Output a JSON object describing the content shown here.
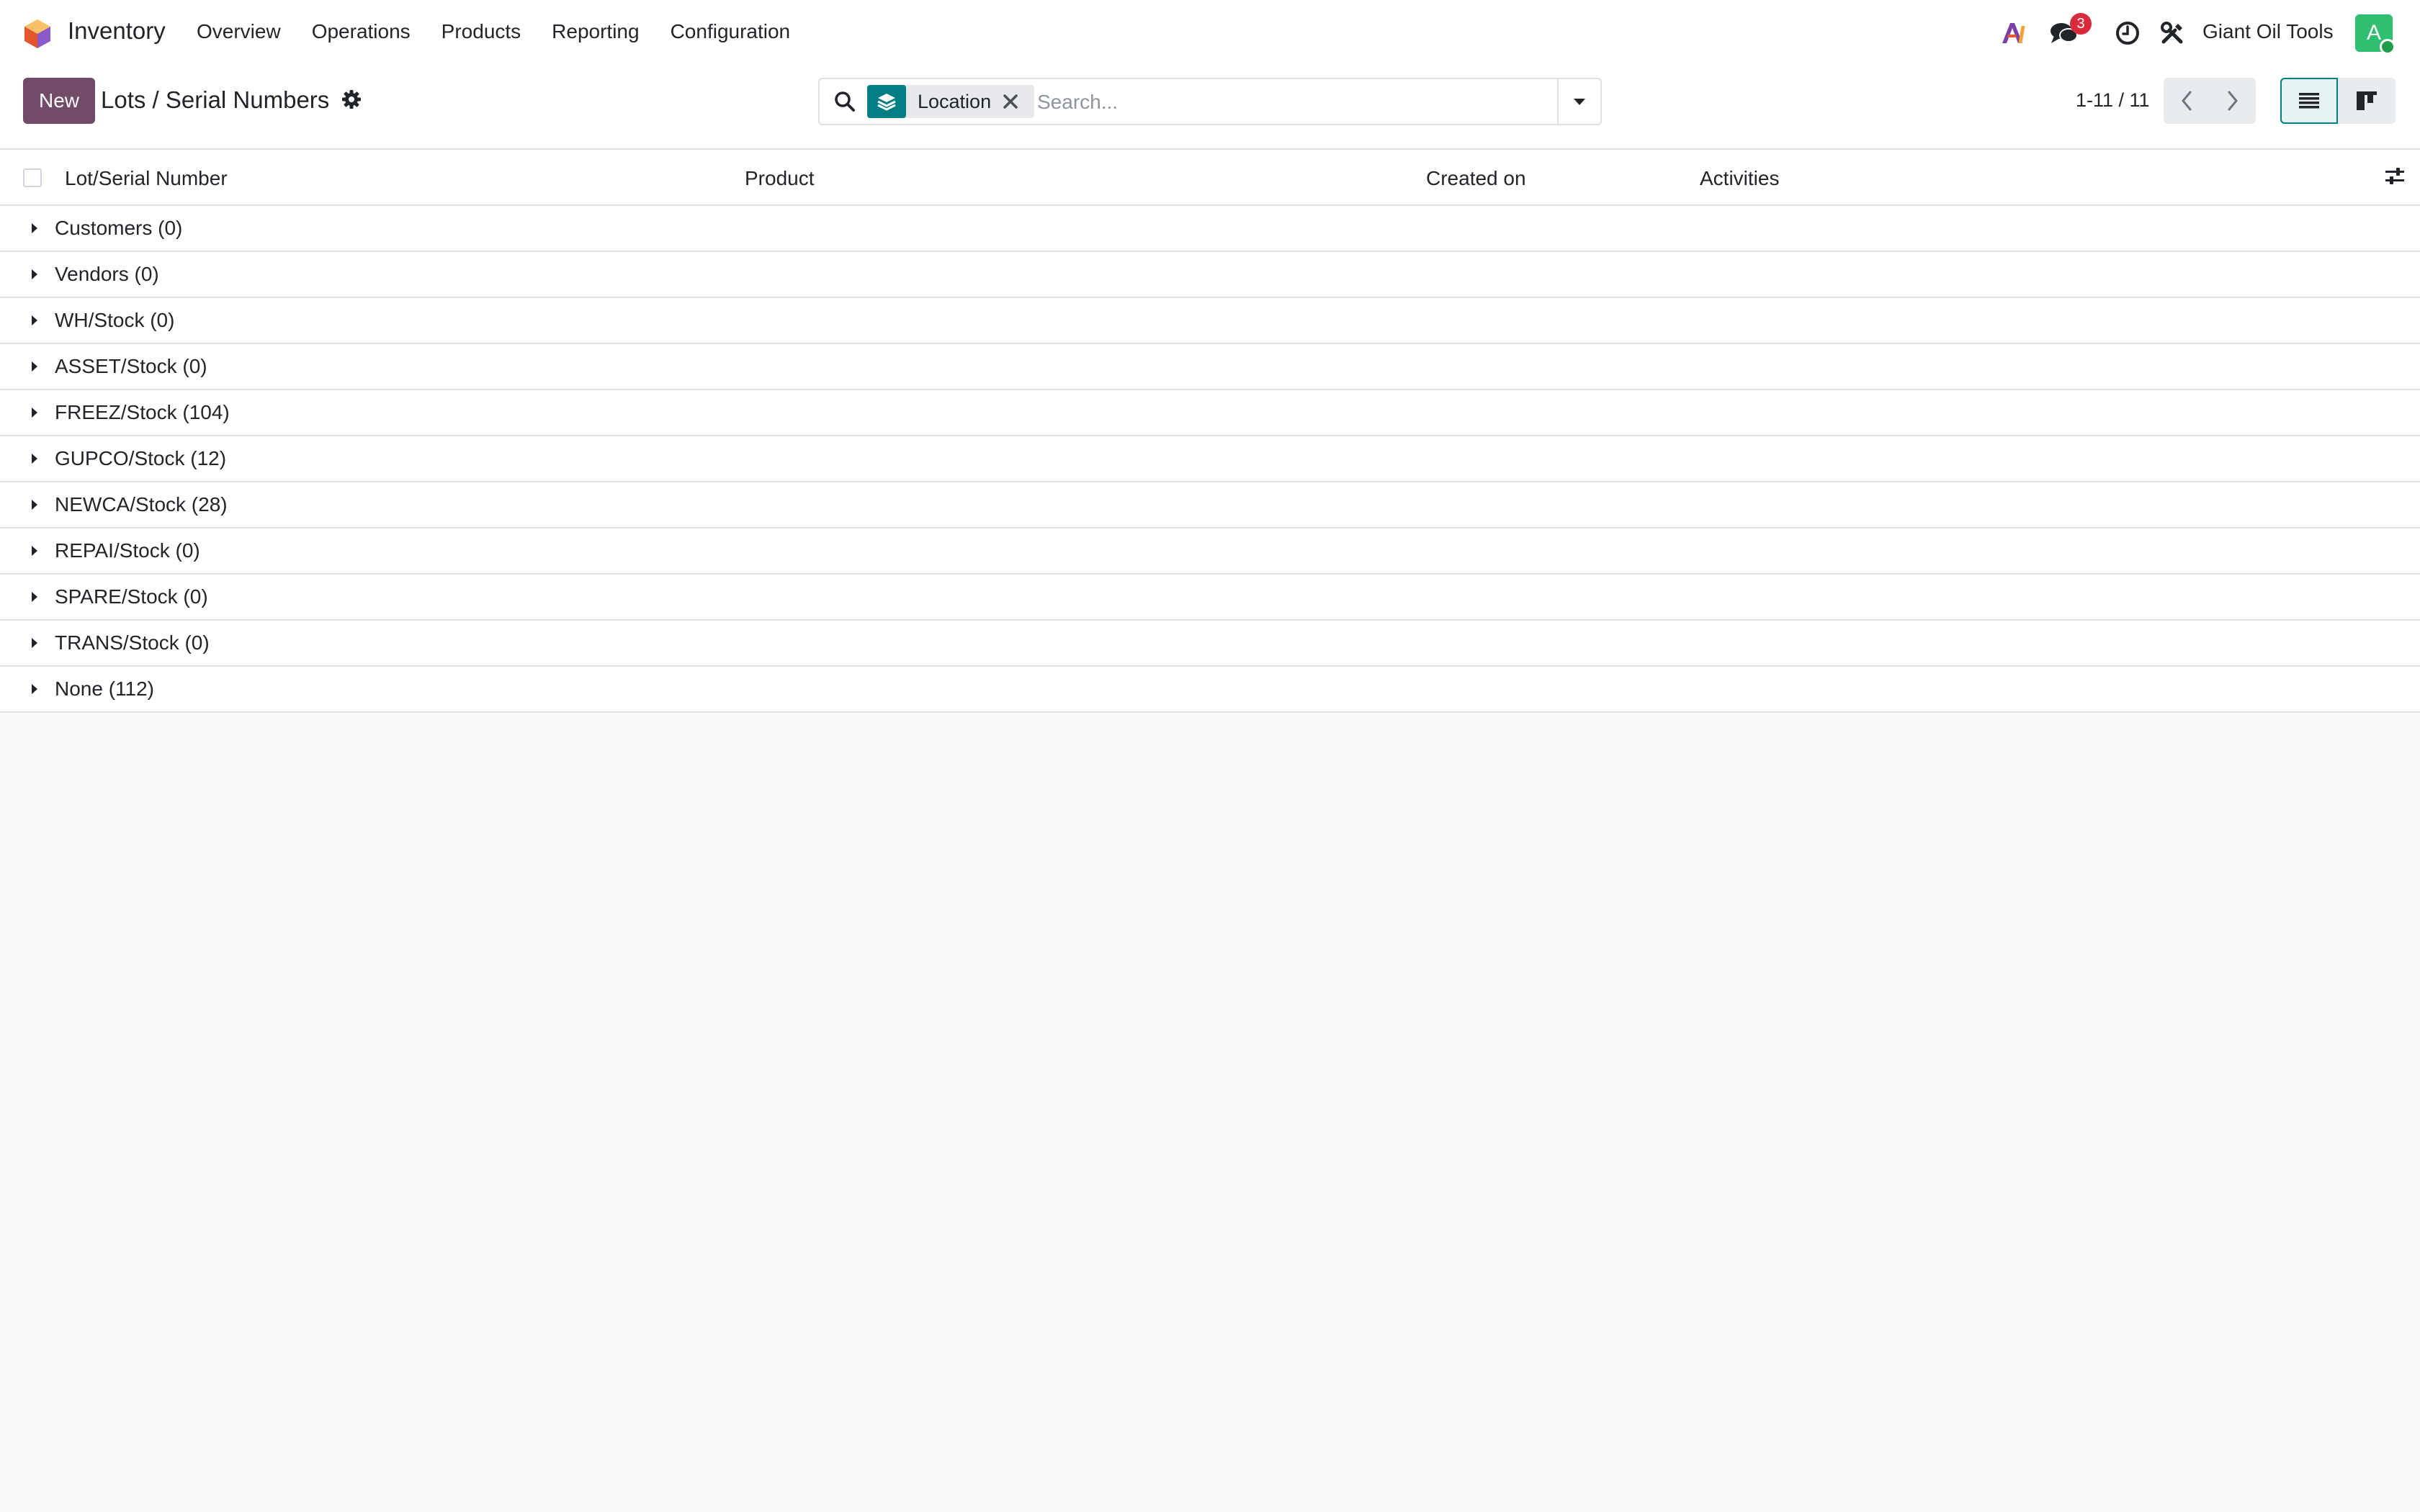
{
  "app": {
    "name": "Inventory",
    "menu": [
      "Overview",
      "Operations",
      "Products",
      "Reporting",
      "Configuration"
    ]
  },
  "systray": {
    "messages_count": "3",
    "company": "Giant Oil Tools",
    "avatar_letter": "A"
  },
  "control": {
    "new_label": "New",
    "breadcrumb": "Lots / Serial Numbers",
    "search": {
      "facet_label": "Location",
      "placeholder": "Search..."
    },
    "pager": "1-11 / 11"
  },
  "table": {
    "columns": [
      "Lot/Serial Number",
      "Product",
      "Created on",
      "Activities"
    ],
    "groups": [
      "Customers (0)",
      "Vendors (0)",
      "WH/Stock (0)",
      "ASSET/Stock (0)",
      "FREEZ/Stock (104)",
      "GUPCO/Stock (12)",
      "NEWCA/Stock (28)",
      "REPAI/Stock (0)",
      "SPARE/Stock (0)",
      "TRANS/Stock (0)",
      "None (112)"
    ]
  },
  "colors": {
    "brand": "#714b67",
    "accent": "#017e84",
    "badge": "#d92b3b",
    "avatar": "#2fbf71"
  }
}
